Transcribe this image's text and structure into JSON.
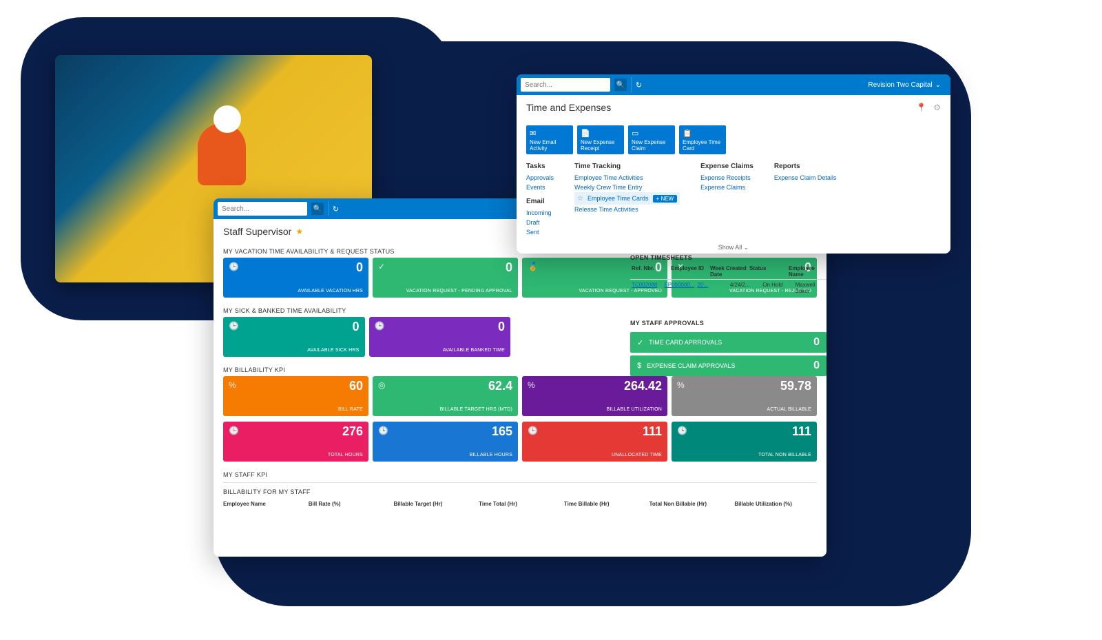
{
  "search_placeholder": "Search...",
  "company": "Revision Two Capital",
  "p1": {
    "title": "Staff Supervisor",
    "s1": "MY VACATION TIME AVAILABILITY & REQUEST STATUS",
    "t1": [
      {
        "v": "0",
        "l": "AVAILABLE VACATION HRS"
      },
      {
        "v": "0",
        "l": "VACATION REQUEST - PENDING APPROVAL"
      },
      {
        "v": "0",
        "l": "VACATION REQUEST - APPROVED"
      },
      {
        "v": "0",
        "l": "VACATION REQUEST - REJECTED"
      }
    ],
    "s2": "MY SICK & BANKED TIME AVAILABILITY",
    "t2": [
      {
        "v": "0",
        "l": "AVAILABLE SICK HRS"
      },
      {
        "v": "0",
        "l": "AVAILABLE BANKED TIME"
      }
    ],
    "s3": "MY BILLABILITY KPI",
    "t3": [
      {
        "v": "60",
        "l": "BILL RATE"
      },
      {
        "v": "62.4",
        "l": "BILLABLE TARGET HRS (MTD)"
      },
      {
        "v": "264.42",
        "l": "BILLABLE UTILIZATION"
      },
      {
        "v": "59.78",
        "l": "ACTUAL BILLABLE"
      }
    ],
    "t4": [
      {
        "v": "276",
        "l": "TOTAL HOURS"
      },
      {
        "v": "165",
        "l": "BILLABLE HOURS"
      },
      {
        "v": "111",
        "l": "UNALLOCATED TIME"
      },
      {
        "v": "111",
        "l": "TOTAL NON BILLABLE"
      }
    ],
    "s4": "MY STAFF KPI",
    "s5": "BILLABILITY FOR MY STAFF",
    "cols": [
      "Employee Name",
      "Bill Rate (%)",
      "Billable Target (Hr)",
      "Time Total (Hr)",
      "Time Billable (Hr)",
      "Total Non Billable (Hr)",
      "Billable Utilization (%)"
    ]
  },
  "p2": {
    "title": "Time and Expenses",
    "actions": [
      "New Email Activity",
      "New Expense Receipt",
      "New Expense Claim",
      "Employee Time Card"
    ],
    "tasks_h": "Tasks",
    "tasks": [
      "Approvals",
      "Events"
    ],
    "email_h": "Email",
    "email": [
      "Incoming",
      "Draft",
      "Sent"
    ],
    "tt_h": "Time Tracking",
    "tt": [
      "Employee Time Activities",
      "Weekly Crew Time Entry",
      "Employee Time Cards",
      "Release Time Activities"
    ],
    "new_badge": "+ NEW",
    "ec_h": "Expense Claims",
    "ec": [
      "Expense Receipts",
      "Expense Claims"
    ],
    "rp_h": "Reports",
    "rp": [
      "Expense Claim Details"
    ],
    "showall": "Show All"
  },
  "side": {
    "ot_h": "OPEN TIMESHEETS",
    "ot_cols": [
      "Ref. Nbr.",
      "Employee ID",
      "Week Created Date",
      "Status",
      "Employee Name"
    ],
    "ot_row": [
      "TC002088",
      "EP000000...",
      "20...",
      "4/24/2...",
      "On Hold",
      "Maxwell Baker"
    ],
    "sa_h": "MY STAFF APPROVALS",
    "a1": {
      "l": "TIME CARD APRROVALS",
      "v": "0"
    },
    "a2": {
      "l": "EXPENSE CLAIM APPROVALS",
      "v": "0"
    }
  }
}
